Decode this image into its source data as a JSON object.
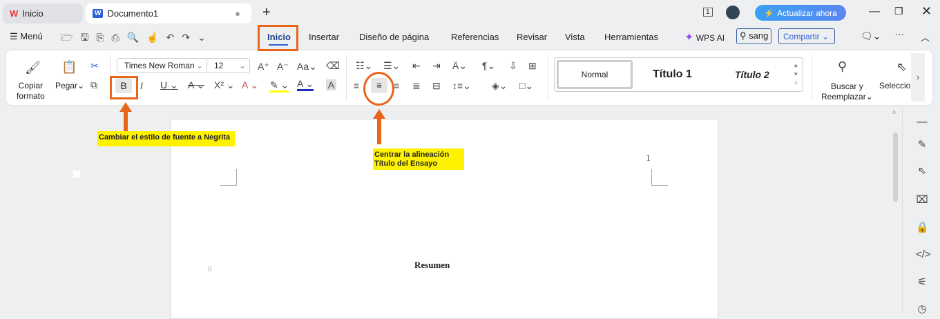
{
  "tabs": [
    {
      "label": "Inicio",
      "icon": "wps-logo-icon"
    },
    {
      "label": "Documento1",
      "icon": "word-doc-icon"
    }
  ],
  "window": {
    "update_label": "Actualizar ahora",
    "page_count": "1"
  },
  "menu": {
    "menu_label": "Menú",
    "items": [
      "Inicio",
      "Insertar",
      "Diseño de página",
      "Referencias",
      "Revisar",
      "Vista",
      "Herramientas"
    ],
    "ai_label": "WPS AI",
    "search_value": "sang",
    "share_label": "Compartir"
  },
  "ribbon": {
    "copy_format": [
      "Copiar",
      "formato"
    ],
    "paste": "Pegar",
    "font_name": "Times New Roman",
    "font_size": "12",
    "styles": [
      "Normal",
      "Título 1",
      "Título 2"
    ],
    "find": [
      "Buscar y",
      "Reemplazar"
    ],
    "select": "Seleccionar"
  },
  "annotations": {
    "bold_note": "Cambiar el estilo de fuente a Negrita",
    "center_note": [
      "Centrar la alineación",
      "Título del Ensayo"
    ],
    "accent": "#e8651a",
    "note_color": "#fff200"
  },
  "document": {
    "page_number": "1",
    "heading": "Resumen"
  }
}
